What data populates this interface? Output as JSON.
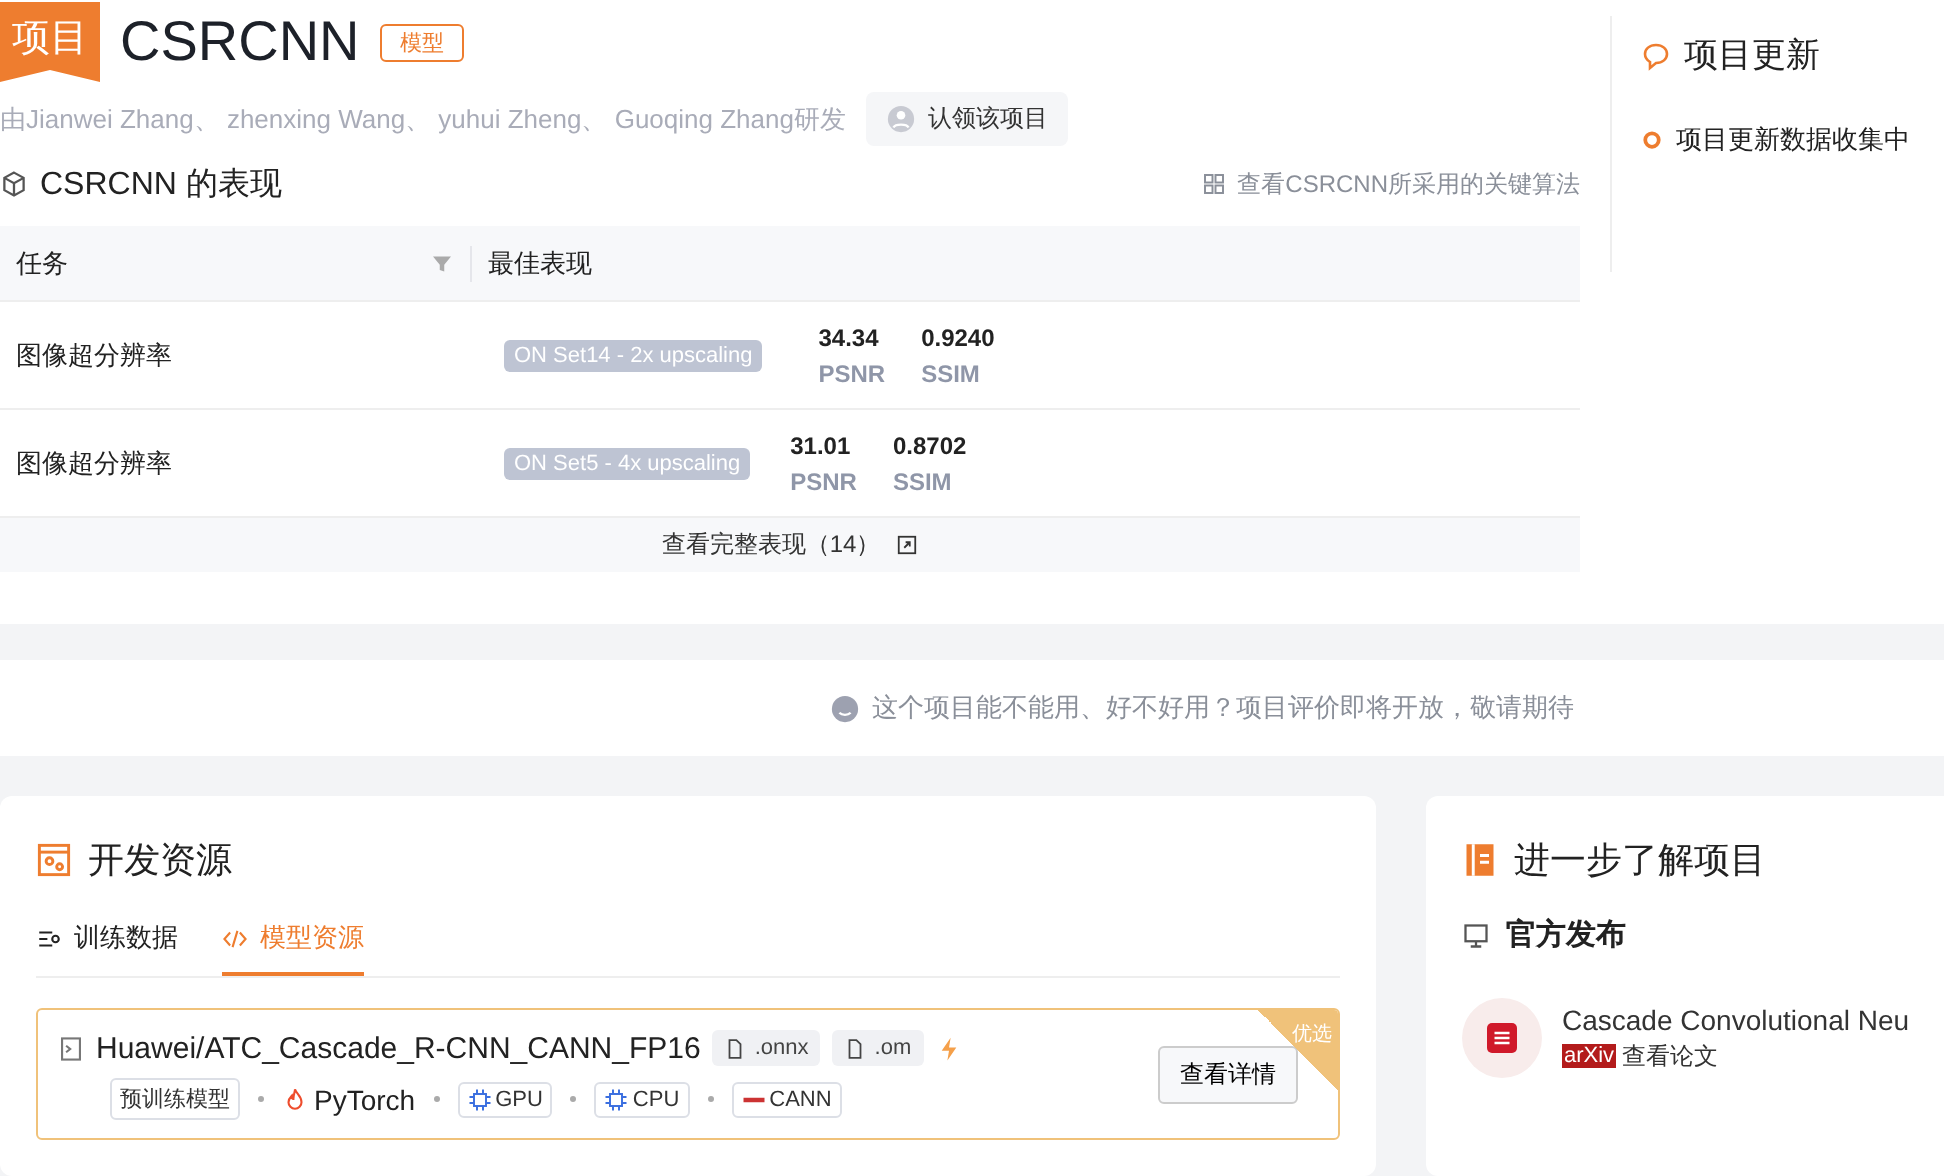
{
  "badge": "项目",
  "title": "CSRCNN",
  "tag": "模型",
  "authors": "由Jianwei Zhang、 zhenxing Wang、 yuhui Zheng、 Guoqing Zhang研发",
  "claim_button": "认领该项目",
  "performance": {
    "title": "CSRCNN 的表现",
    "algorithms_link": "查看CSRCNN所采用的关键算法",
    "columns": [
      "任务",
      "最佳表现"
    ],
    "rows": [
      {
        "task": "图像超分辨率",
        "dataset": "ON Set14 - 2x upscaling",
        "metrics": [
          {
            "value": "34.34",
            "name": "PSNR"
          },
          {
            "value": "0.9240",
            "name": "SSIM"
          }
        ]
      },
      {
        "task": "图像超分辨率",
        "dataset": "ON Set5 - 4x upscaling",
        "metrics": [
          {
            "value": "31.01",
            "name": "PSNR"
          },
          {
            "value": "0.8702",
            "name": "SSIM"
          }
        ]
      }
    ],
    "full_link": "查看完整表现（14）"
  },
  "updates": {
    "title": "项目更新",
    "status": "项目更新数据收集中"
  },
  "evaluation_notice": "这个项目能不能用、好不好用？项目评价即将开放，敬请期待",
  "resources": {
    "title": "开发资源",
    "tabs": [
      {
        "label": "训练数据",
        "selected": false
      },
      {
        "label": "模型资源",
        "selected": true
      }
    ],
    "model": {
      "name": "Huawei/ATC_Cascade_R-CNN_CANN_FP16",
      "files": [
        ".onnx",
        ".om"
      ],
      "type": "预训练模型",
      "framework": "PyTorch",
      "hardware": [
        {
          "label": "GPU",
          "kind": "chip"
        },
        {
          "label": "CPU",
          "kind": "chip"
        },
        {
          "label": "CANN",
          "kind": "cann"
        }
      ],
      "ribbon": "优选",
      "detail_button": "查看详情"
    }
  },
  "learn_more": {
    "title": "进一步了解项目",
    "section": "官方发布",
    "paper": {
      "title": "Cascade Convolutional Neu",
      "source": "arXiv",
      "link": "查看论文"
    }
  }
}
